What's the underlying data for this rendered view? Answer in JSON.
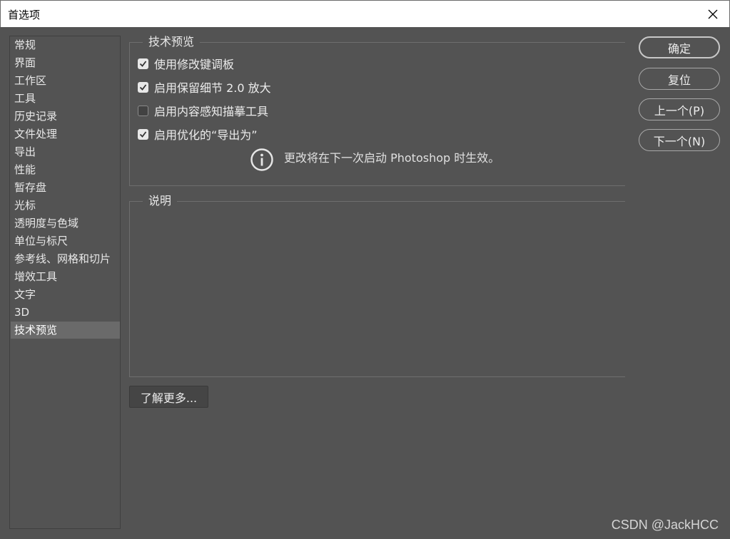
{
  "window": {
    "title": "首选项"
  },
  "sidebar": {
    "items": [
      {
        "label": "常规"
      },
      {
        "label": "界面"
      },
      {
        "label": "工作区"
      },
      {
        "label": "工具"
      },
      {
        "label": "历史记录"
      },
      {
        "label": "文件处理"
      },
      {
        "label": "导出"
      },
      {
        "label": "性能"
      },
      {
        "label": "暂存盘"
      },
      {
        "label": "光标"
      },
      {
        "label": "透明度与色域"
      },
      {
        "label": "单位与标尺"
      },
      {
        "label": "参考线、网格和切片"
      },
      {
        "label": "增效工具"
      },
      {
        "label": "文字"
      },
      {
        "label": "3D"
      },
      {
        "label": "技术预览"
      }
    ],
    "selected": "技术预览"
  },
  "tech_preview": {
    "group_title": "技术预览",
    "options": [
      {
        "label": "使用修改键调板",
        "checked": true
      },
      {
        "label": "启用保留细节 2.0 放大",
        "checked": true
      },
      {
        "label": "启用内容感知描摹工具",
        "checked": false
      },
      {
        "label": "启用优化的“导出为”",
        "checked": true
      }
    ],
    "info_icon": "info-circle-icon",
    "info_text": "更改将在下一次启动 Photoshop 时生效。"
  },
  "description": {
    "group_title": "说明"
  },
  "learn_more_label": "了解更多...",
  "buttons": {
    "ok": "确定",
    "reset": "复位",
    "prev": "上一个(P)",
    "next": "下一个(N)"
  },
  "watermark": "CSDN @JackHCC",
  "colors": {
    "background": "#535353",
    "selected_item": "#6a6a6a",
    "titlebar": "#ffffff"
  }
}
